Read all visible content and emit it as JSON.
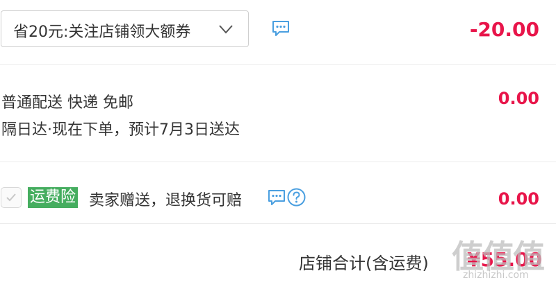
{
  "coupon": {
    "label": "省20元:关注店铺领大额券",
    "amount": "-20.00"
  },
  "delivery": {
    "line1": "普通配送 快递 免邮",
    "line2": "隔日达·现在下单，预计7月3日送达",
    "amount": "0.00"
  },
  "insurance": {
    "badge": "运费险",
    "text": "卖家赠送，退换货可赔",
    "amount": "0.00",
    "checked": true
  },
  "total": {
    "label": "店铺合计(含运费)",
    "value": "¥55.00"
  },
  "watermark": {
    "big": "值值值",
    "small": "zhizhizhi.com"
  },
  "icons": {
    "coupon_chevron": "chevron-down-icon",
    "coupon_message": "message-icon",
    "insurance_message": "message-icon",
    "insurance_help": "question-circle-icon",
    "insurance_check": "check-icon"
  },
  "colors": {
    "accent_red": "#e8154a",
    "icon_blue": "#4a9fe0",
    "badge_green": "#45ad5f",
    "divider": "#ececec"
  }
}
